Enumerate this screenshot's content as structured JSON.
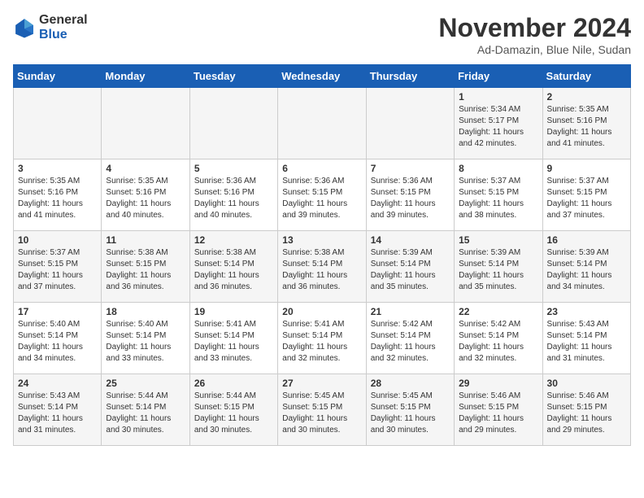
{
  "logo": {
    "general": "General",
    "blue": "Blue"
  },
  "header": {
    "month": "November 2024",
    "location": "Ad-Damazin, Blue Nile, Sudan"
  },
  "weekdays": [
    "Sunday",
    "Monday",
    "Tuesday",
    "Wednesday",
    "Thursday",
    "Friday",
    "Saturday"
  ],
  "weeks": [
    [
      {
        "day": "",
        "info": ""
      },
      {
        "day": "",
        "info": ""
      },
      {
        "day": "",
        "info": ""
      },
      {
        "day": "",
        "info": ""
      },
      {
        "day": "",
        "info": ""
      },
      {
        "day": "1",
        "info": "Sunrise: 5:34 AM\nSunset: 5:17 PM\nDaylight: 11 hours\nand 42 minutes."
      },
      {
        "day": "2",
        "info": "Sunrise: 5:35 AM\nSunset: 5:16 PM\nDaylight: 11 hours\nand 41 minutes."
      }
    ],
    [
      {
        "day": "3",
        "info": "Sunrise: 5:35 AM\nSunset: 5:16 PM\nDaylight: 11 hours\nand 41 minutes."
      },
      {
        "day": "4",
        "info": "Sunrise: 5:35 AM\nSunset: 5:16 PM\nDaylight: 11 hours\nand 40 minutes."
      },
      {
        "day": "5",
        "info": "Sunrise: 5:36 AM\nSunset: 5:16 PM\nDaylight: 11 hours\nand 40 minutes."
      },
      {
        "day": "6",
        "info": "Sunrise: 5:36 AM\nSunset: 5:15 PM\nDaylight: 11 hours\nand 39 minutes."
      },
      {
        "day": "7",
        "info": "Sunrise: 5:36 AM\nSunset: 5:15 PM\nDaylight: 11 hours\nand 39 minutes."
      },
      {
        "day": "8",
        "info": "Sunrise: 5:37 AM\nSunset: 5:15 PM\nDaylight: 11 hours\nand 38 minutes."
      },
      {
        "day": "9",
        "info": "Sunrise: 5:37 AM\nSunset: 5:15 PM\nDaylight: 11 hours\nand 37 minutes."
      }
    ],
    [
      {
        "day": "10",
        "info": "Sunrise: 5:37 AM\nSunset: 5:15 PM\nDaylight: 11 hours\nand 37 minutes."
      },
      {
        "day": "11",
        "info": "Sunrise: 5:38 AM\nSunset: 5:15 PM\nDaylight: 11 hours\nand 36 minutes."
      },
      {
        "day": "12",
        "info": "Sunrise: 5:38 AM\nSunset: 5:14 PM\nDaylight: 11 hours\nand 36 minutes."
      },
      {
        "day": "13",
        "info": "Sunrise: 5:38 AM\nSunset: 5:14 PM\nDaylight: 11 hours\nand 36 minutes."
      },
      {
        "day": "14",
        "info": "Sunrise: 5:39 AM\nSunset: 5:14 PM\nDaylight: 11 hours\nand 35 minutes."
      },
      {
        "day": "15",
        "info": "Sunrise: 5:39 AM\nSunset: 5:14 PM\nDaylight: 11 hours\nand 35 minutes."
      },
      {
        "day": "16",
        "info": "Sunrise: 5:39 AM\nSunset: 5:14 PM\nDaylight: 11 hours\nand 34 minutes."
      }
    ],
    [
      {
        "day": "17",
        "info": "Sunrise: 5:40 AM\nSunset: 5:14 PM\nDaylight: 11 hours\nand 34 minutes."
      },
      {
        "day": "18",
        "info": "Sunrise: 5:40 AM\nSunset: 5:14 PM\nDaylight: 11 hours\nand 33 minutes."
      },
      {
        "day": "19",
        "info": "Sunrise: 5:41 AM\nSunset: 5:14 PM\nDaylight: 11 hours\nand 33 minutes."
      },
      {
        "day": "20",
        "info": "Sunrise: 5:41 AM\nSunset: 5:14 PM\nDaylight: 11 hours\nand 32 minutes."
      },
      {
        "day": "21",
        "info": "Sunrise: 5:42 AM\nSunset: 5:14 PM\nDaylight: 11 hours\nand 32 minutes."
      },
      {
        "day": "22",
        "info": "Sunrise: 5:42 AM\nSunset: 5:14 PM\nDaylight: 11 hours\nand 32 minutes."
      },
      {
        "day": "23",
        "info": "Sunrise: 5:43 AM\nSunset: 5:14 PM\nDaylight: 11 hours\nand 31 minutes."
      }
    ],
    [
      {
        "day": "24",
        "info": "Sunrise: 5:43 AM\nSunset: 5:14 PM\nDaylight: 11 hours\nand 31 minutes."
      },
      {
        "day": "25",
        "info": "Sunrise: 5:44 AM\nSunset: 5:14 PM\nDaylight: 11 hours\nand 30 minutes."
      },
      {
        "day": "26",
        "info": "Sunrise: 5:44 AM\nSunset: 5:15 PM\nDaylight: 11 hours\nand 30 minutes."
      },
      {
        "day": "27",
        "info": "Sunrise: 5:45 AM\nSunset: 5:15 PM\nDaylight: 11 hours\nand 30 minutes."
      },
      {
        "day": "28",
        "info": "Sunrise: 5:45 AM\nSunset: 5:15 PM\nDaylight: 11 hours\nand 30 minutes."
      },
      {
        "day": "29",
        "info": "Sunrise: 5:46 AM\nSunset: 5:15 PM\nDaylight: 11 hours\nand 29 minutes."
      },
      {
        "day": "30",
        "info": "Sunrise: 5:46 AM\nSunset: 5:15 PM\nDaylight: 11 hours\nand 29 minutes."
      }
    ]
  ]
}
